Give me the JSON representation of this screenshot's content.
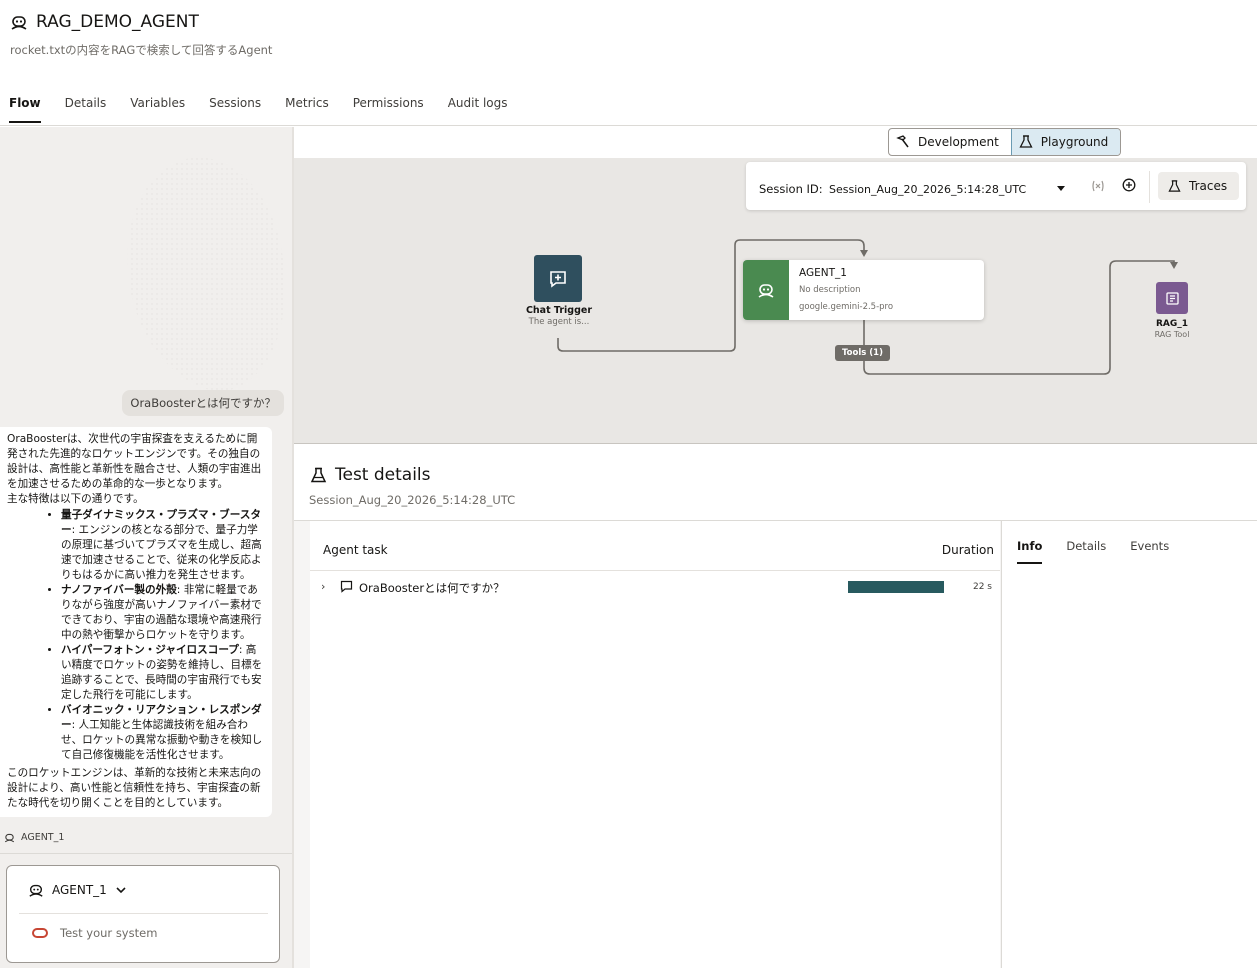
{
  "app": {
    "title": "RAG_DEMO_AGENT",
    "subtitle": "rocket.txtの内容をRAGで検索して回答するAgent"
  },
  "tabs": [
    "Flow",
    "Details",
    "Variables",
    "Sessions",
    "Metrics",
    "Permissions",
    "Audit logs"
  ],
  "active_tab": "Flow",
  "mode": {
    "development": "Development",
    "playground": "Playground",
    "active": "Playground"
  },
  "session": {
    "label": "Session ID:",
    "value": "Session_Aug_20_2026_5:14:28_UTC",
    "traces": "Traces"
  },
  "flow": {
    "trigger": {
      "name": "Chat Trigger",
      "description": "The agent is..."
    },
    "agent": {
      "name": "AGENT_1",
      "description": "No description",
      "model": "google.gemini-2.5-pro"
    },
    "tools_badge": "Tools (1)",
    "rag": {
      "name": "RAG_1",
      "type": "RAG Tool"
    }
  },
  "chat": {
    "user_message": "OraBoosterとは何ですか？",
    "answer_intro": "OraBoosterは、次世代の宇宙探査を支えるために開発された先進的なロケットエンジンです。その独自の設計は、高性能と革新性を融合させ、人類の宇宙進出を加速させるための革命的な一歩となります。",
    "answer_features_heading": "主な特徴は以下の通りです。",
    "answer_features": [
      {
        "name": "量子ダイナミックス・プラズマ・ブースター",
        "text": ": エンジンの核となる部分で、量子力学の原理に基づいてプラズマを生成し、超高速で加速させることで、従来の化学反応よりもはるかに高い推力を発生させます。"
      },
      {
        "name": "ナノファイバー製の外殻",
        "text": ": 非常に軽量でありながら強度が高いナノファイバー素材でできており、宇宙の過酷な環境や高速飛行中の熱や衝撃からロケットを守ります。"
      },
      {
        "name": "ハイパーフォトン・ジャイロスコープ",
        "text": ": 高い精度でロケットの姿勢を維持し、目標を追跡することで、長時間の宇宙飛行でも安定した飛行を可能にします。"
      },
      {
        "name": "バイオニック・リアクション・レスポンダー",
        "text": ": 人工知能と生体認識技術を組み合わせ、ロケットの異常な振動や動きを検知して自己修復機能を活性化させます。"
      }
    ],
    "answer_outro": "このロケットエンジンは、革新的な技術と未来志向の設計により、高い性能と信頼性を持ち、宇宙探査の新たな時代を切り開くことを目的としています。",
    "agent_label": "AGENT_1",
    "input_agent": "AGENT_1",
    "input_placeholder": "Test your system"
  },
  "test_details": {
    "title": "Test details",
    "session": "Session_Aug_20_2026_5:14:28_UTC",
    "col_task": "Agent task",
    "col_duration": "Duration",
    "rows": [
      {
        "label": "OraBoosterとは何ですか？",
        "duration": "22 s",
        "bar_fraction": 1.0
      }
    ],
    "detail_tabs": [
      "Info",
      "Details",
      "Events"
    ],
    "active_detail_tab": "Info"
  },
  "colors": {
    "trigger_node": "#2f4f5e",
    "agent_node": "#4a8a50",
    "rag_node": "#7b5a91",
    "duration_bar": "#285a5f",
    "active_mode": "#dbeaf2"
  }
}
